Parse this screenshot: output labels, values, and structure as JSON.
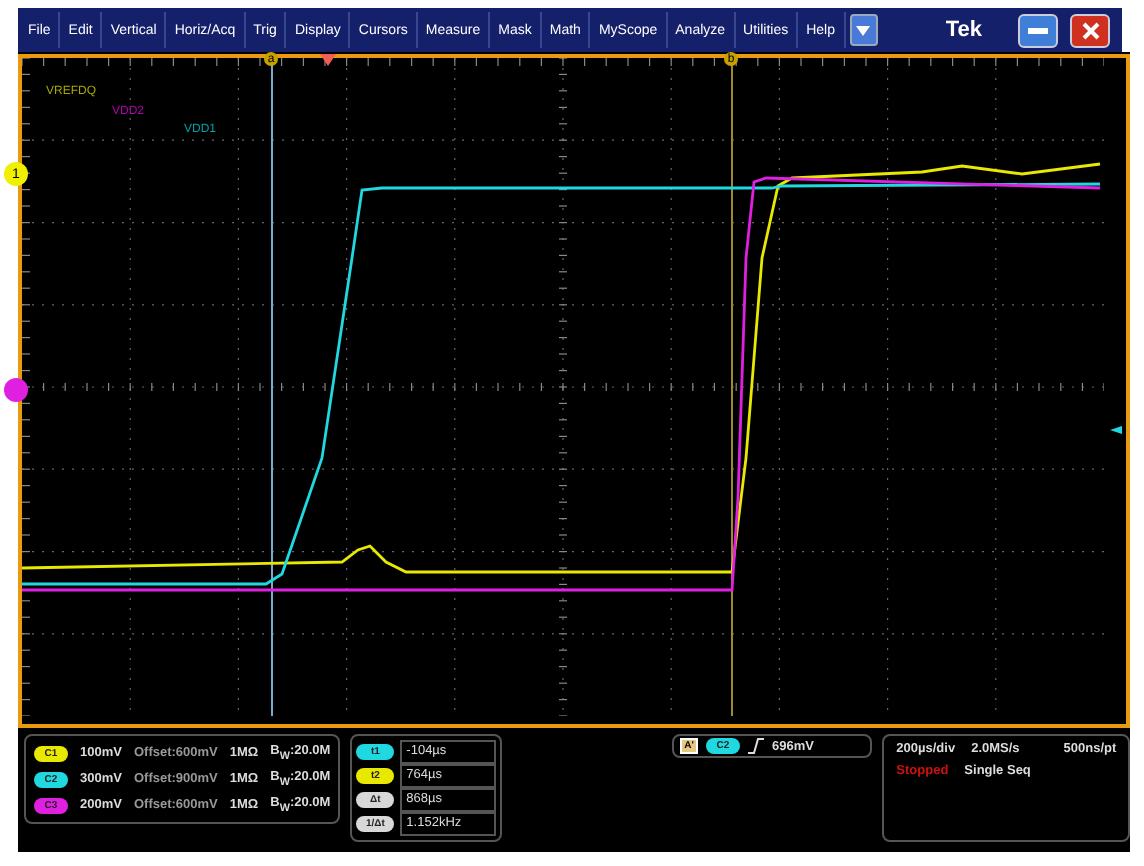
{
  "menu": [
    "File",
    "Edit",
    "Vertical",
    "Horiz/Acq",
    "Trig",
    "Display",
    "Cursors",
    "Measure",
    "Mask",
    "Math",
    "MyScope",
    "Analyze",
    "Utilities",
    "Help"
  ],
  "brand": "Tek",
  "cursor_markers": [
    {
      "label": "a",
      "color": "#c8a000"
    },
    {
      "label": "b",
      "color": "#c8a000"
    }
  ],
  "ref_markers": [
    {
      "label": "1",
      "color": "#f0f000"
    },
    {
      "color": "#e020e0"
    }
  ],
  "trace_labels": [
    {
      "text": "VREFDQ",
      "color": "#a8a800"
    },
    {
      "text": "VDD2",
      "color": "#b000b0"
    },
    {
      "text": "VDD1",
      "color": "#00a0a8"
    }
  ],
  "channels": [
    {
      "badge": "C1",
      "scale": "100mV",
      "offset": "Offset:600mV",
      "impedance": "1MΩ",
      "bandwidth": "B$_{W}$:20.0M",
      "color": "#e8e800"
    },
    {
      "badge": "C2",
      "scale": "300mV",
      "offset": "Offset:900mV",
      "impedance": "1MΩ",
      "bandwidth": "B$_{W}$:20.0M",
      "color": "#20d8e0"
    },
    {
      "badge": "C3",
      "scale": "200mV",
      "offset": "Offset:600mV",
      "impedance": "1MΩ",
      "bandwidth": "B$_{W}$:20.0M",
      "color": "#e020e0"
    }
  ],
  "cursors": [
    {
      "badge": "t1",
      "value": "-104µs",
      "color": "#20d8e0"
    },
    {
      "badge": "t2",
      "value": "764µs",
      "color": "#e8e800"
    },
    {
      "badge": "Δt",
      "value": "868µs",
      "color": "#d8d8d8"
    },
    {
      "badge": "1/Δt",
      "value": "1.152kHz",
      "color": "#d8d8d8"
    }
  ],
  "trigger": {
    "mode": "A'",
    "source": "C2",
    "level": "696mV"
  },
  "acquisition": {
    "time_per_div": "200µs/div",
    "sample_rate": "2.0MS/s",
    "resolution": "500ns/pt",
    "status": "Stopped",
    "mode": "Single Seq"
  }
}
